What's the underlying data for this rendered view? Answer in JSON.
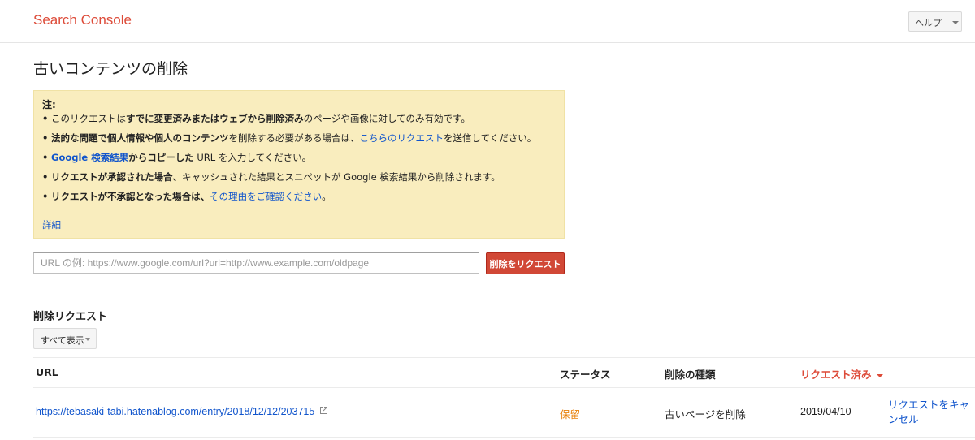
{
  "header": {
    "brand": "Search Console",
    "help_label": "ヘルプ"
  },
  "page_title": "古いコンテンツの削除",
  "notice": {
    "heading": "注:",
    "items": [
      {
        "pre": "このリクエストは",
        "bold": "すでに変更済みまたはウェブから削除済み",
        "post": "のページや画像に対してのみ有効です。"
      },
      {
        "bold": "法的な問題で個人情報や個人のコンテンツ",
        "mid": "を削除する必要がある場合は、",
        "link": "こちらのリクエスト",
        "post": "を送信してください。"
      },
      {
        "link": "Google 検索結果",
        "bold": "からコピーした",
        "post": " URL を入力してください。"
      },
      {
        "bold": "リクエストが承認された場合、",
        "post": "キャッシュされた結果とスニペットが Google 検索結果から削除されます。"
      },
      {
        "bold": "リクエストが不承認となった場合は、",
        "link": "その理由をご確認ください",
        "post": "。"
      }
    ],
    "detail_link": "詳細"
  },
  "request_form": {
    "placeholder": "URL の例: https://www.google.com/url?url=http://www.example.com/oldpage",
    "value": "",
    "submit_label": "削除をリクエスト"
  },
  "requests": {
    "title": "削除リクエスト",
    "filter_label": "すべて表示",
    "columns": {
      "url": "URL",
      "status": "ステータス",
      "type": "削除の種類",
      "requested": "リクエスト済み"
    },
    "rows": [
      {
        "url": "https://tebasaki-tabi.hatenablog.com/entry/2018/12/12/203715",
        "status": "保留",
        "type": "古いページを削除",
        "date": "2019/04/10",
        "action": "リクエストをキャンセル"
      }
    ]
  },
  "colors": {
    "brand": "#dd4b39",
    "link": "#1155cc",
    "pending": "#e8820c",
    "notice_bg": "#f9edbe",
    "primary_button": "#d14836"
  },
  "icons": {
    "external_link": "external-link-icon",
    "dropdown": "chevron-down-icon"
  }
}
